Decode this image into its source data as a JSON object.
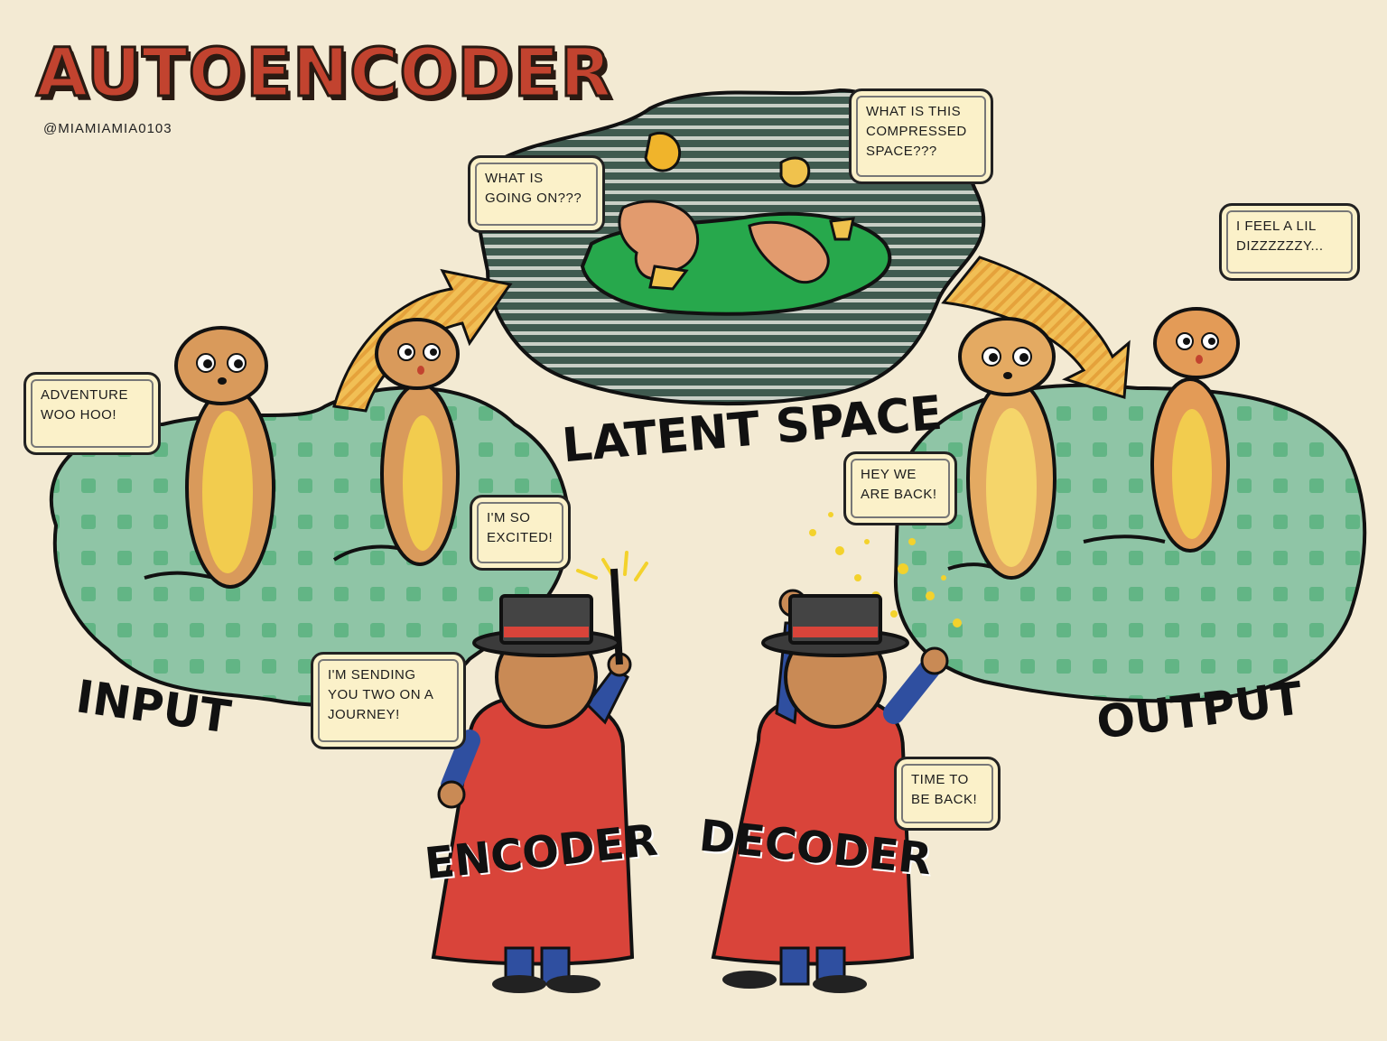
{
  "title": "AUTOENCODER",
  "handle": "@MIAMIAMIA0103",
  "labels": {
    "input": "INPUT",
    "latent": "LATENT SPACE",
    "output": "OUTPUT",
    "encoder": "ENCODER",
    "decoder": "DECODER"
  },
  "bubbles": {
    "adventure": [
      "ADVENTURE",
      "WOO HOO!"
    ],
    "excited": [
      "I'M SO",
      "EXCITED!"
    ],
    "going_on": [
      "WHAT IS",
      "GOING ON???"
    ],
    "compressed": [
      "WHAT IS THIS",
      "COMPRESSED",
      "SPACE???"
    ],
    "dizzy": [
      "I FEEL A LIL",
      "DIZZZZZZY..."
    ],
    "back": [
      "HEY WE",
      "ARE BACK!"
    ],
    "sending": [
      "I'M SENDING",
      "YOU TWO ON A",
      "JOURNEY!"
    ],
    "time": [
      "TIME TO",
      "BE BACK!"
    ]
  },
  "colors": {
    "background": "#f3ead3",
    "title": "#c2432f",
    "island": "#8fc5a6",
    "island_dots": "#67b48a",
    "latent_grass": "#27a84c",
    "meerkat": "#d99a5b",
    "meerkat_belly": "#f2cc4e",
    "cape": "#d9443a",
    "coat": "#2f4fa0",
    "arrow": "#f0b84a"
  }
}
